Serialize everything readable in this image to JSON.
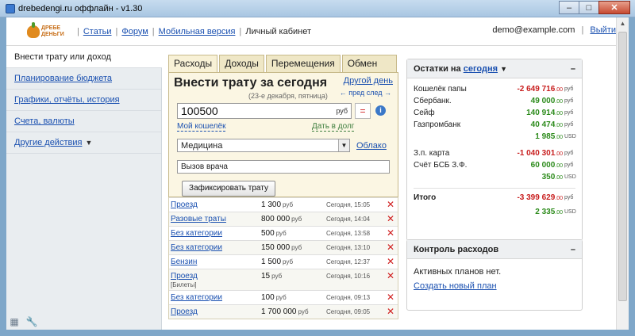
{
  "window": {
    "title": "drebedengi.ru оффлайн - v1.30"
  },
  "header": {
    "logo_text": "ДРЕБЕ ДЕНЬГИ",
    "links": [
      "Статьи",
      "Форум",
      "Мобильная версия"
    ],
    "current": "Личный кабинет",
    "email": "demo@example.com",
    "logout": "Выйти"
  },
  "sidebar": {
    "active": "Внести трату или доход",
    "items": [
      "Планирование бюджета",
      "Графики, отчёты, история",
      "Счета, валюты",
      "Другие действия"
    ]
  },
  "tabs": [
    "Расходы",
    "Доходы",
    "Перемещения",
    "Обмен валют"
  ],
  "form": {
    "title": "Внести трату за сегодня",
    "subtitle": "(23-е декабря, пятница)",
    "other_day": "Другой день",
    "prev_next": "← пред след →",
    "amount": "100500",
    "currency": "руб",
    "eq": "=",
    "info": "i",
    "wallet": "Мой кошелёк",
    "loan": "Дать в долг",
    "category": "Медицина",
    "cloud": "Облако",
    "comment": "Вызов врача",
    "submit": "Зафиксировать трату"
  },
  "transactions": [
    {
      "category": "Проезд",
      "amount": "1 300",
      "currency": "руб",
      "time": "Сегодня, 15:05",
      "tag": ""
    },
    {
      "category": "Разовые траты",
      "amount": "800 000",
      "currency": "руб",
      "time": "Сегодня, 14:04",
      "tag": ""
    },
    {
      "category": "Без категории",
      "amount": "500",
      "currency": "руб",
      "time": "Сегодня, 13:58",
      "tag": ""
    },
    {
      "category": "Без категории",
      "amount": "150 000",
      "currency": "руб",
      "time": "Сегодня, 13:10",
      "tag": ""
    },
    {
      "category": "Бензин",
      "amount": "1 500",
      "currency": "руб",
      "time": "Сегодня, 12:37",
      "tag": ""
    },
    {
      "category": "Проезд",
      "amount": "15",
      "currency": "руб",
      "time": "Сегодня, 10:16",
      "tag": "[Билеты]"
    },
    {
      "category": "Без категории",
      "amount": "100",
      "currency": "руб",
      "time": "Сегодня, 09:13",
      "tag": ""
    },
    {
      "category": "Проезд",
      "amount": "1 700 000",
      "currency": "руб",
      "time": "Сегодня, 09:05",
      "tag": ""
    }
  ],
  "balances": {
    "title": "Остатки на",
    "title_link": "сегодня",
    "rows": [
      {
        "name": "Кошелёк папы",
        "amount": "-2 649 716",
        "cents": ".00",
        "currency": "руб",
        "sign": "neg"
      },
      {
        "name": "Сбербанк.",
        "amount": "49 000",
        "cents": ".00",
        "currency": "руб",
        "sign": "pos"
      },
      {
        "name": "Сейф",
        "amount": "140 914",
        "cents": ".00",
        "currency": "руб",
        "sign": "pos"
      },
      {
        "name": "Газпромбанк",
        "amount": "40 474",
        "cents": ".00",
        "currency": "руб",
        "sign": "pos"
      },
      {
        "name": "",
        "amount": "1 985",
        "cents": ".00",
        "currency": "USD",
        "sign": "pos"
      },
      {
        "name": "З.п. карта",
        "amount": "-1 040 301",
        "cents": ".00",
        "currency": "руб",
        "sign": "neg"
      },
      {
        "name": "Счёт БСБ З.Ф.",
        "amount": "60 000",
        "cents": ".00",
        "currency": "руб",
        "sign": "pos"
      },
      {
        "name": "",
        "amount": "350",
        "cents": ".00",
        "currency": "USD",
        "sign": "pos"
      }
    ],
    "total_label": "Итого",
    "total_rub": "-3 399 629",
    "total_rub_cents": ".00",
    "total_rub_cur": "руб",
    "total_usd": "2 335",
    "total_usd_cents": ".00",
    "total_usd_cur": "USD"
  },
  "plans": {
    "title": "Контроль расходов",
    "text": "Активных планов нет.",
    "link": "Создать новый план"
  },
  "colors": {
    "negative": "#c81e1e",
    "positive": "#2b8a1a",
    "link": "#1a50b0"
  }
}
